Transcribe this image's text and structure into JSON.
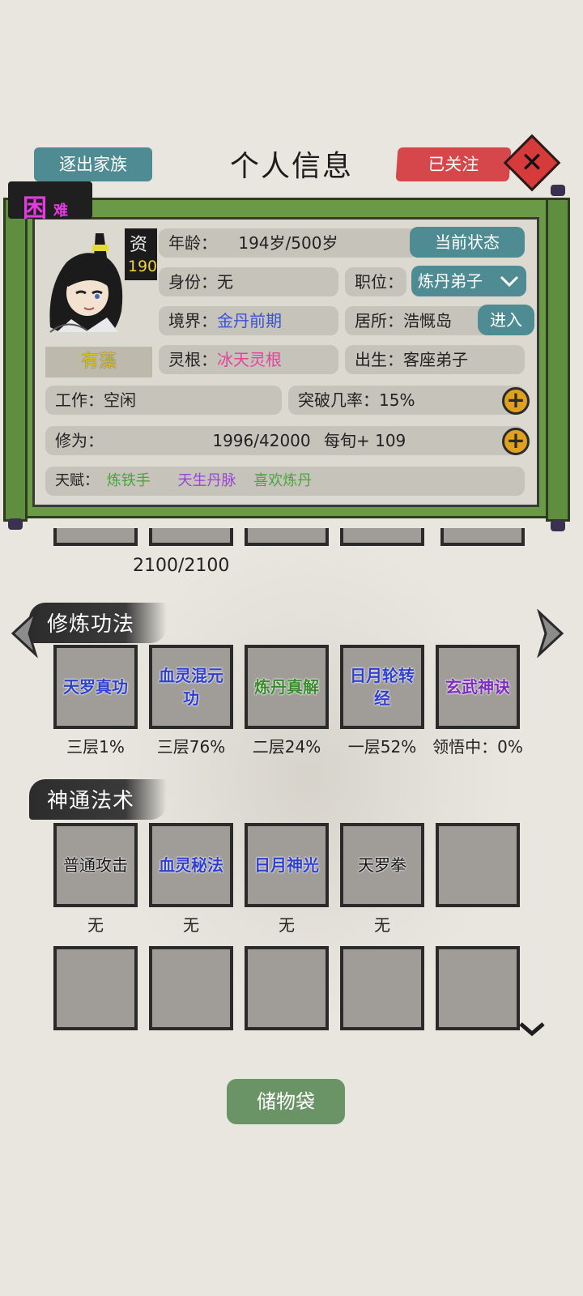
{
  "header": {
    "expel_label": "逐出家族",
    "title": "个人信息",
    "follow_label": "已关注",
    "close_icon": "close-x-icon"
  },
  "profile": {
    "difficulty_main": "困",
    "difficulty_sub": "难",
    "aptitude_label": "资",
    "aptitude_value": "190",
    "name": "有藻",
    "age_label": "年龄：",
    "age_value": "194岁/500岁",
    "status_button": "当前状态",
    "identity_label": "身份：",
    "identity_value": "无",
    "position_label": "职位：",
    "position_value": "炼丹弟子",
    "realm_label": "境界：",
    "realm_value": "金丹前期",
    "residence_label": "居所：",
    "residence_value": "浩慨岛",
    "enter_button": "进入",
    "root_label": "灵根：",
    "root_value": "冰天灵根",
    "origin_label": "出生：",
    "origin_value": "客座弟子",
    "work_label": "工作：",
    "work_value": "空闲",
    "breakthrough_label": "突破几率：",
    "breakthrough_value": "15%",
    "cultivation_label": "修为：",
    "cultivation_value": "1996/42000",
    "cultivation_rate": "每旬+ 109",
    "talent_label": "天赋：",
    "talents": [
      "炼铁手",
      "天生丹脉",
      "喜欢炼丹"
    ],
    "colors": {
      "blue": "#3a52d6",
      "pink": "#e2449a",
      "green": "#49a53b",
      "purple": "#9a45d8"
    }
  },
  "equipment_row": {
    "caption": "2100/2100"
  },
  "techniques": {
    "title": "修炼功法",
    "items": [
      {
        "name": "天罗真功",
        "progress": "三层1%"
      },
      {
        "name": "血灵混元功",
        "progress": "三层76%"
      },
      {
        "name": "炼丹真解",
        "progress": "二层24%"
      },
      {
        "name": "日月轮转经",
        "progress": "一层52%"
      },
      {
        "name": "玄武神诀",
        "progress": "领悟中：0%"
      }
    ]
  },
  "skills": {
    "title": "神通法术",
    "items": [
      {
        "name": "普通攻击",
        "caption": "无"
      },
      {
        "name": "血灵秘法",
        "caption": "无"
      },
      {
        "name": "日月神光",
        "caption": "无"
      },
      {
        "name": "天罗拳",
        "caption": "无"
      }
    ]
  },
  "storage_label": "储物袋"
}
